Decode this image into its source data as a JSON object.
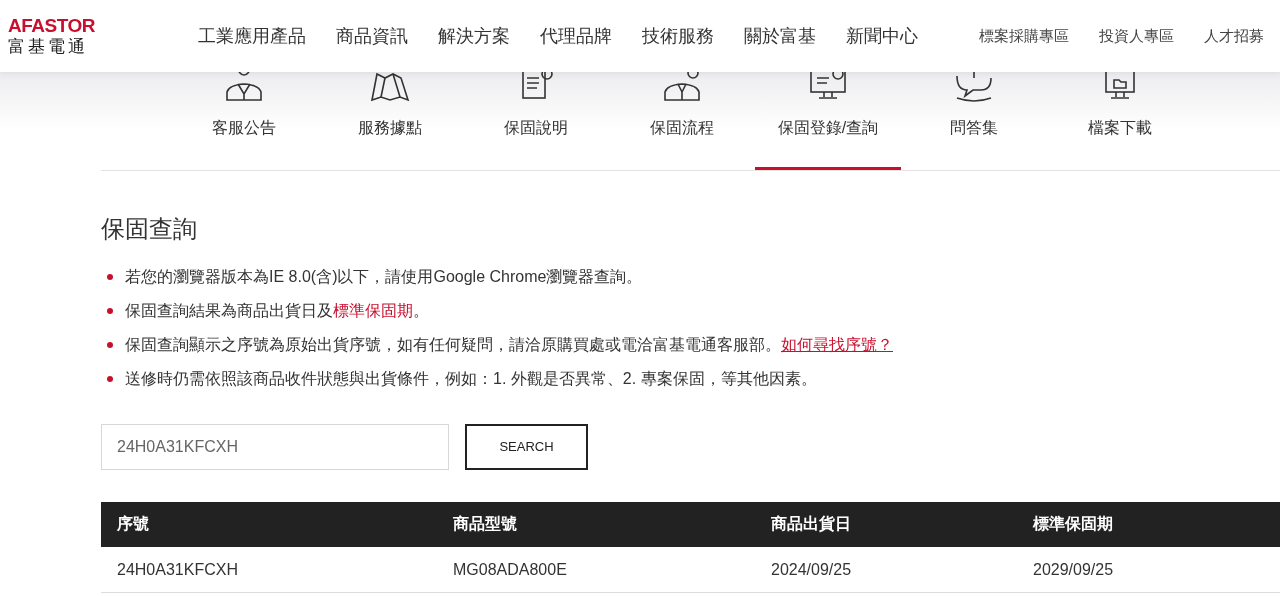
{
  "logo": {
    "brand": "AFASTOR",
    "name": "富基電通"
  },
  "main_nav": [
    "工業應用產品",
    "商品資訊",
    "解決方案",
    "代理品牌",
    "技術服務",
    "關於富基",
    "新聞中心"
  ],
  "utility_nav": [
    "標案採購專區",
    "投資人專區",
    "人才招募"
  ],
  "service_tabs": [
    {
      "label": "客服公告",
      "kind": "person",
      "selected": false
    },
    {
      "label": "服務據點",
      "kind": "map",
      "selected": false
    },
    {
      "label": "保固說明",
      "kind": "document",
      "selected": false
    },
    {
      "label": "保固流程",
      "kind": "worker",
      "selected": false
    },
    {
      "label": "保固登錄/查詢",
      "kind": "monitor",
      "selected": true
    },
    {
      "label": "問答集",
      "kind": "chat",
      "selected": false
    },
    {
      "label": "檔案下載",
      "kind": "download",
      "selected": false
    }
  ],
  "heading": "保固查詢",
  "notes": [
    [
      {
        "text": "若您的瀏覽器版本為IE 8.0(含)以下，請使用Google Chrome瀏覽器查詢。",
        "kind": "plain"
      }
    ],
    [
      {
        "text": "保固查詢結果為商品出貨日及",
        "kind": "plain"
      },
      {
        "text": "標準保固期",
        "kind": "highlight"
      },
      {
        "text": "。",
        "kind": "plain"
      }
    ],
    [
      {
        "text": "保固查詢顯示之序號為原始出貨序號，如有任何疑問，請洽原購買處或電洽富基電通客服部。",
        "kind": "plain"
      },
      {
        "text": "如何尋找序號？",
        "kind": "link"
      }
    ],
    [
      {
        "text": "送修時仍需依照該商品收件狀態與出貨條件，例如：1. 外觀是否異常、2. 專案保固，等其他因素。",
        "kind": "plain"
      }
    ]
  ],
  "search": {
    "value": "24H0A31KFCXH",
    "button": "SEARCH"
  },
  "table": {
    "columns": [
      "序號",
      "商品型號",
      "商品出貨日",
      "標準保固期"
    ],
    "rows": [
      [
        "24H0A31KFCXH",
        "MG08ADA800E",
        "2024/09/25",
        "2029/09/25"
      ]
    ]
  }
}
